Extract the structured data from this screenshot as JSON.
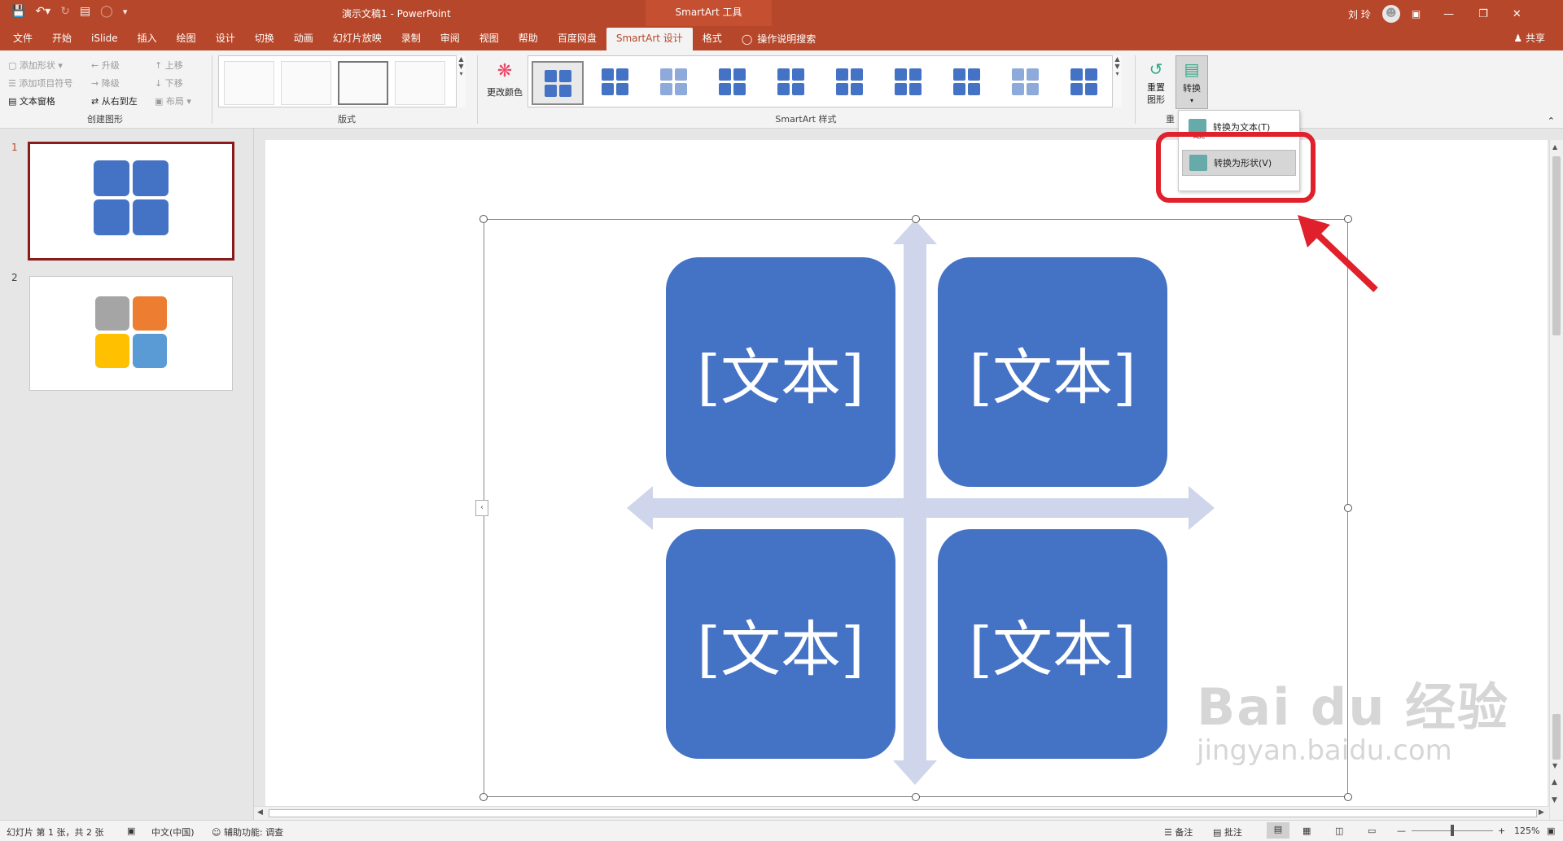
{
  "titlebar": {
    "doc_title": "演示文稿1  -  PowerPoint",
    "context_tools": "SmartArt 工具",
    "user": "刘 玲"
  },
  "tabs": [
    "文件",
    "开始",
    "iSlide",
    "插入",
    "绘图",
    "设计",
    "切换",
    "动画",
    "幻灯片放映",
    "录制",
    "审阅",
    "视图",
    "帮助",
    "百度网盘",
    "SmartArt 设计",
    "格式",
    "操作说明搜索"
  ],
  "share_label": "共享",
  "ribbon": {
    "create": {
      "add_shape": "添加形状",
      "add_bullet": "添加项目符号",
      "text_pane": "文本窗格",
      "promote": "升级",
      "demote": "降级",
      "rtl": "从右到左",
      "move_up": "上移",
      "move_down": "下移",
      "layout": "布局",
      "label": "创建图形"
    },
    "layouts_label": "版式",
    "change_colors": "更改颜色",
    "styles_label": "SmartArt 样式",
    "reset_graphic": "重置图形",
    "convert": "转换",
    "reset_label": "重"
  },
  "dropdown": {
    "to_text": "转换为文本(T)",
    "to_text_sub": "ABC",
    "to_shapes": "转换为形状(V)"
  },
  "slides": [
    "1",
    "2"
  ],
  "smartart_text": [
    "[文本]",
    "[文本]",
    "[文本]",
    "[文本]"
  ],
  "status": {
    "slide_info": "幻灯片 第 1 张，共 2 张",
    "language": "中文(中国)",
    "accessibility": "辅助功能: 调查",
    "notes": "备注",
    "comments": "批注",
    "zoom": "125%"
  },
  "watermark": {
    "brand": "Bai du 经验",
    "url": "jingyan.baidu.com"
  },
  "colors": {
    "accent": "#b7472a",
    "tile": "#4472c4",
    "arrow": "#cfd5ea",
    "highlight": "#e0202a"
  }
}
